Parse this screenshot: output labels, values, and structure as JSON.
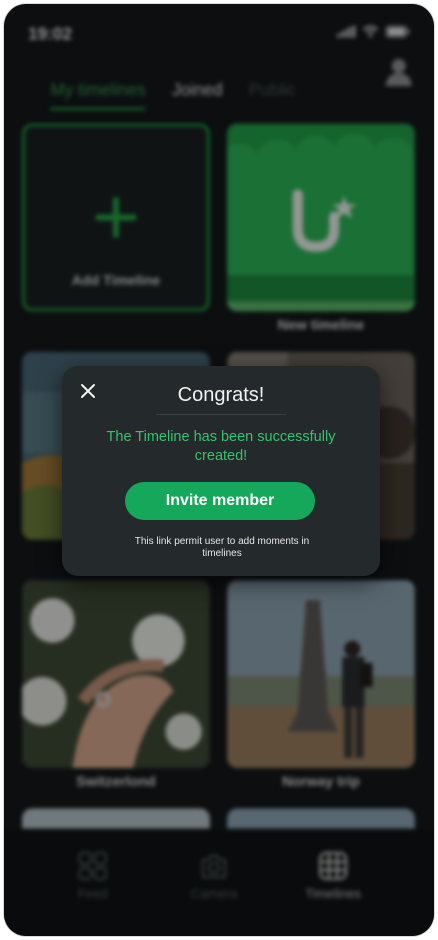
{
  "status_bar": {
    "time": "19:02"
  },
  "tabs": [
    {
      "label": "My timelines",
      "active": true
    },
    {
      "label": "Joined",
      "active": false
    },
    {
      "label": "Public",
      "active": false
    }
  ],
  "grid": {
    "add_label": "Add Timeline",
    "cards": [
      {
        "caption": "New timeline"
      },
      {
        "caption": ""
      },
      {
        "caption": ""
      },
      {
        "caption": "Switzerlond"
      },
      {
        "caption": "Norway trip"
      }
    ]
  },
  "nav": [
    {
      "label": "Feed",
      "icon": "grid-icon",
      "active": false
    },
    {
      "label": "Camera",
      "icon": "camera-icon",
      "active": false
    },
    {
      "label": "Timelines",
      "icon": "timeline-icon",
      "active": true
    }
  ],
  "modal": {
    "title": "Congrats!",
    "message": "The Timeline has been successfully created!",
    "invite_label": "Invite member",
    "note": "This link permit user to add moments in timelines"
  },
  "colors": {
    "accent": "#16a85a",
    "accent_text": "#35c46a",
    "background": "#14181b",
    "modal": "#24292b"
  }
}
